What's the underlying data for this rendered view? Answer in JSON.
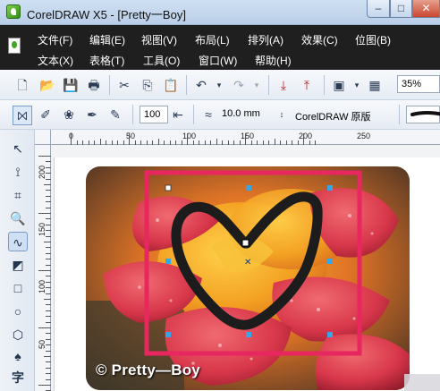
{
  "window": {
    "title": "CorelDRAW X5 - [Pretty一Boy]",
    "min_glyph": "–",
    "max_glyph": "□",
    "close_glyph": "✕"
  },
  "menu": {
    "row1": [
      "文件(F)",
      "编辑(E)",
      "视图(V)",
      "布局(L)",
      "排列(A)",
      "效果(C)",
      "位图(B)"
    ],
    "row2": [
      "文本(X)",
      "表格(T)",
      "工具(O)",
      "窗口(W)",
      "帮助(H)"
    ]
  },
  "toolbar": {
    "zoom": "35%"
  },
  "property_bar": {
    "smoothing": "100",
    "width": "10.0 mm",
    "brush_type": "CorelDRAW 原版"
  },
  "toolbox": {
    "text_tool": "字"
  },
  "ruler": {
    "h_labels": [
      "0",
      "50",
      "100",
      "150",
      "200",
      "250"
    ],
    "v_labels": [
      "200",
      "150",
      "100",
      "50"
    ]
  },
  "artwork": {
    "watermark": "© Pretty—Boy",
    "frame_color": "#e8265f",
    "heart_color": "#1c1c1c",
    "handle_color": "#35a7e8"
  }
}
